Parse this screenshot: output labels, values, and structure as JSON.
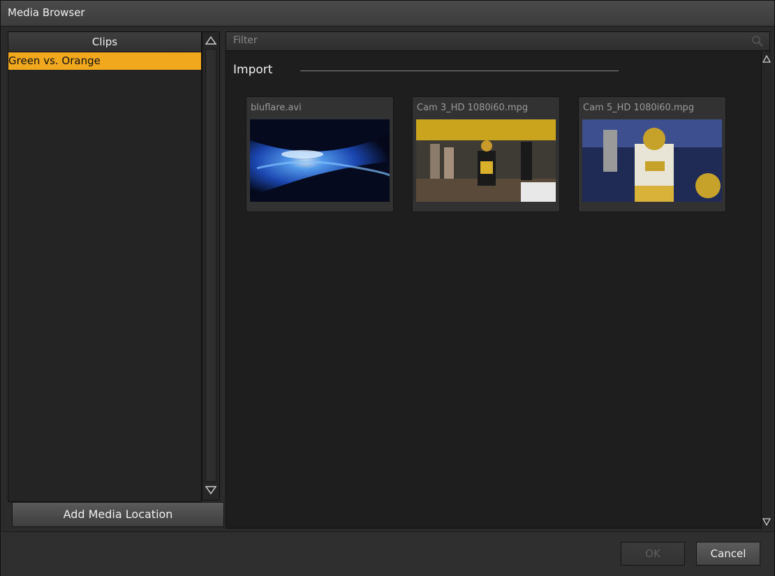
{
  "window": {
    "title": "Media Browser"
  },
  "clips": {
    "header": "Clips",
    "items": [
      {
        "label": "Green vs. Orange",
        "selected": true
      }
    ],
    "add_location_label": "Add Media Location"
  },
  "filter": {
    "placeholder": "Filter"
  },
  "group": {
    "title": "Import"
  },
  "media": [
    {
      "label": "bluflare.avi",
      "thumb": "blue-flare"
    },
    {
      "label": "Cam 3_HD 1080i60.mpg",
      "thumb": "football-cam3"
    },
    {
      "label": "Cam 5_HD 1080i60.mpg",
      "thumb": "football-cam5"
    }
  ],
  "buttons": {
    "ok": "OK",
    "cancel": "Cancel"
  },
  "colors": {
    "accent": "#f2a81d",
    "background": "#1e1e1e"
  },
  "icons": {
    "search": "search-icon",
    "scroll_up": "triangle-up-icon",
    "scroll_down": "triangle-down-icon"
  }
}
